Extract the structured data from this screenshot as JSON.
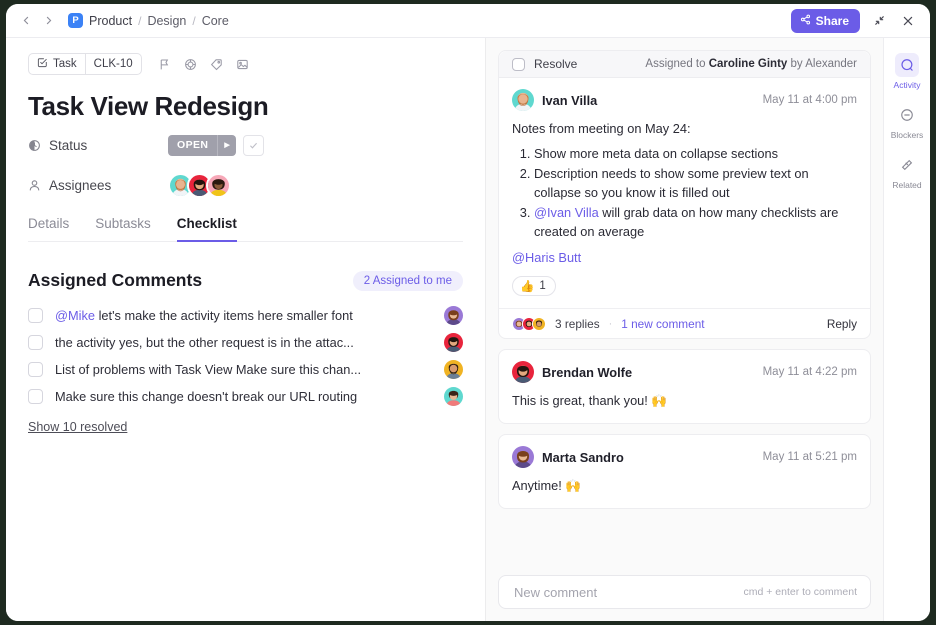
{
  "topbar": {
    "back_icon": "chevron-left-icon",
    "forward_icon": "chevron-right-icon",
    "workspace_initial": "P",
    "breadcrumb": [
      "Product",
      "Design",
      "Core"
    ],
    "separator": "/",
    "share_label": "Share",
    "share_icon": "share-icon",
    "minimize_icon": "collapse-icon",
    "close_icon": "close-icon",
    "accent_color": "#6b5ce7"
  },
  "task": {
    "type_label": "Task",
    "type_icon": "task-check-icon",
    "id": "CLK-10",
    "toolbar_icons": [
      "flag-icon",
      "target-icon",
      "tag-icon",
      "image-icon"
    ],
    "title": "Task View Redesign",
    "fields": [
      {
        "label": "Status",
        "icon": "clock-icon",
        "value": "OPEN",
        "caret": "▶"
      },
      {
        "label": "Assignees",
        "icon": "person-icon"
      }
    ],
    "assignee_avatars": [
      "ivan",
      "brendan",
      "caroline"
    ],
    "tabs": [
      {
        "label": "Details",
        "active": false
      },
      {
        "label": "Subtasks",
        "active": false
      },
      {
        "label": "Checklist",
        "active": true
      }
    ]
  },
  "checklist_section": {
    "title": "Assigned Comments",
    "badge": "2 Assigned to me",
    "badge_color": "#6b5ce7",
    "items": [
      {
        "mention": "@Mike",
        "text": " let's make the activity items here smaller font",
        "avatar": "marta",
        "checked": false
      },
      {
        "mention": "",
        "text": "the activity yes, but the other request is in the attac...",
        "avatar": "brendan",
        "checked": false
      },
      {
        "mention": "",
        "text": "List of problems with Task View Make sure this chan...",
        "avatar": "haris",
        "checked": false
      },
      {
        "mention": "",
        "text": "Make sure this change doesn't break our URL routing",
        "avatar": "ivan",
        "checked": false
      }
    ],
    "show_resolved": "Show 10 resolved"
  },
  "activity": {
    "resolve_label": "Resolve",
    "assigned_prefix": "Assigned to ",
    "assigned_name": "Caroline Ginty",
    "assigned_suffix": " by Alexander",
    "comments": [
      {
        "author": "Ivan Villa",
        "avatar": "ivan",
        "time": "May 11 at 4:00 pm",
        "intro": "Notes from meeting on May 24:",
        "list": [
          {
            "mention": "",
            "text": "Show more meta data on collapse sections"
          },
          {
            "mention": "",
            "text": "Description needs to show some preview text on collapse so you know it is filled out"
          },
          {
            "mention": "@Ivan Villa",
            "text": " will grab data on how many checklists are created on average"
          }
        ],
        "mention_line": "@Haris Butt",
        "reaction_emoji": "👍",
        "reaction_count": "1",
        "replies_avatars": [
          "marta",
          "brendan",
          "haris"
        ],
        "replies_label": "3 replies",
        "dot": "·",
        "new_comment_label": "1 new comment",
        "reply_label": "Reply"
      },
      {
        "author": "Brendan Wolfe",
        "avatar": "brendan",
        "time": "May 11 at 4:22 pm",
        "intro": "This is great, thank you! 🙌"
      },
      {
        "author": "Marta Sandro",
        "avatar": "marta",
        "time": "May 11 at 5:21 pm",
        "intro": "Anytime! 🙌"
      }
    ],
    "composer_placeholder": "New comment",
    "composer_hint": "cmd + enter to comment"
  },
  "rail": {
    "items": [
      {
        "label": "Activity",
        "icon": "activity-icon",
        "active": true
      },
      {
        "label": "Blockers",
        "icon": "blocker-icon",
        "active": false
      },
      {
        "label": "Related",
        "icon": "related-icon",
        "active": false
      }
    ]
  }
}
